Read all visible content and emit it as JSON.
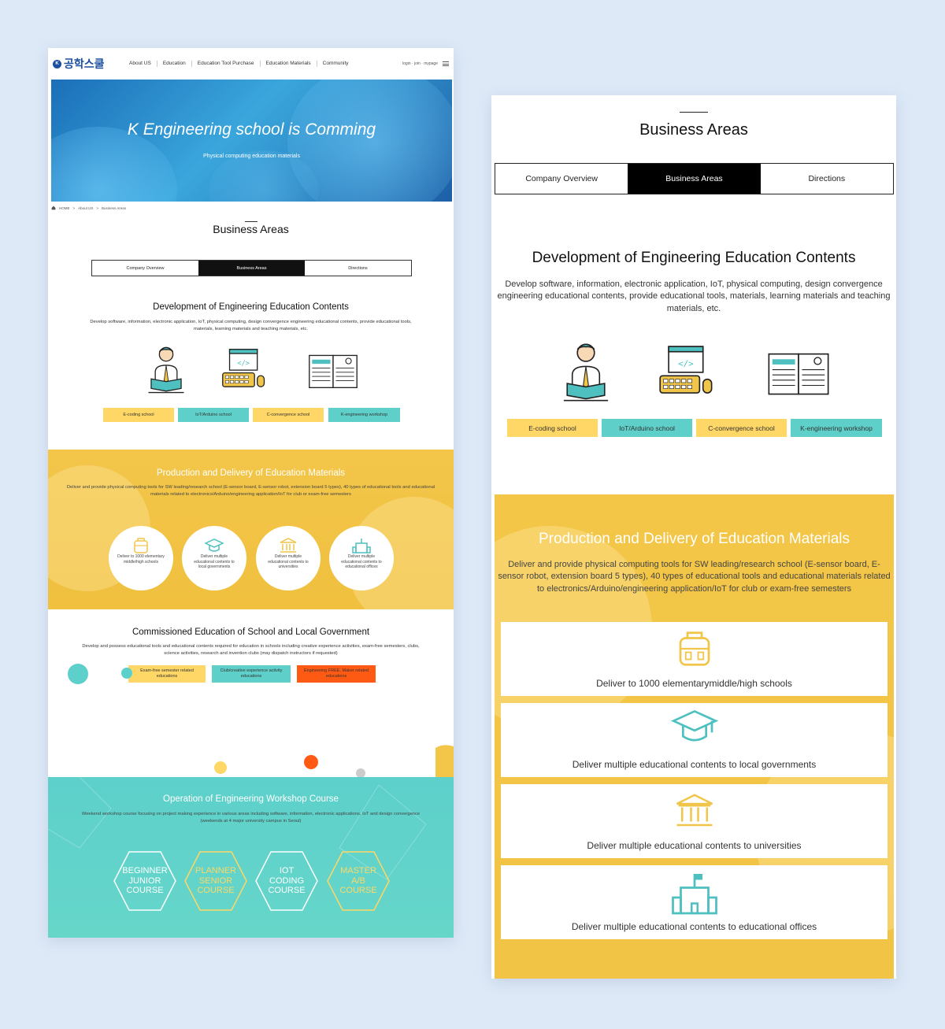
{
  "nav": {
    "logo_text": "공학스쿨",
    "logo_badge": "K",
    "menu": [
      "About US",
      "Education",
      "Education Tool Purchase",
      "Education Materials",
      "Community"
    ],
    "util": "login · join · mypage"
  },
  "hero": {
    "title": "K Engineering school is Comming",
    "subtitle": "Physical computing education materials"
  },
  "breadcrumb": [
    "HOME",
    "About US",
    "Business Areas"
  ],
  "page_title": "Business Areas",
  "tabs": [
    "Company Overview",
    "Business Areas",
    "Directions"
  ],
  "development": {
    "title": "Development of Engineering Education Contents",
    "desc_left": "Develop software, information, electronic application, IoT, physical computing, design convergence engineering educational contents, provide educational tools, materials, learning materials and teaching materials, etc.",
    "desc_right": "Develop software, information, electronic application, IoT, physical computing, design convergence engineering educational contents, provide educational tools, materials, learning materials and teaching materials, etc.",
    "tags": [
      "E-coding school",
      "IoT/Arduino school",
      "C-convergence school",
      "K-engineering workshop"
    ]
  },
  "production": {
    "title": "Production and Delivery of Education Materials",
    "desc_left": "Deliver and provide physical computing tools for SW leading/research school (E-sensor board, E-sensor robot, extension board 5 types), 40 types of educational tools and educational materials related to electronics/Arduino/engineering application/IoT for club or exam-free semesters",
    "desc_right": "Deliver and provide physical computing tools for SW leading/research school (E-sensor board, E-sensor robot, extension board 5 types), 40 types of educational tools and educational materials related to electronics/Arduino/engineering application/IoT for club or exam-free semesters",
    "circles": [
      "Deliver to 1000 elementary middle/high schools",
      "Deliver multiple educational contents to local governments",
      "Deliver multiple educational contents to universities",
      "Deliver multiple educational contents to educational offices"
    ],
    "boxes": [
      "Deliver to 1000 elementarymiddle/high schools",
      "Deliver multiple educational contents to local governments",
      "Deliver multiple educational contents to universities",
      "Deliver multiple educational contents to educational offices"
    ]
  },
  "commissioned": {
    "title": "Commissioned Education of School and Local Government",
    "desc": "Develop and possess educational tools and educational contents required for education in schools including creative experience activities, exam-free semesters, clubs, science activities, research and invention clubs (may dispatch instructors if requested)",
    "tags": [
      "Exam-free semester related educations",
      "Club/creative experience activity educations",
      "Engineering FREE, Maker related educations"
    ]
  },
  "workshop": {
    "title": "Operation of Engineering Workshop Course",
    "desc": "Weekend workshop course focusing on project making experience in various areas including software, information, electronic applications, IoT and design convergence (weekends at 4 major university campus in Seoul)",
    "courses": [
      "BEGINNER\nJUNIOR\nCOURSE",
      "PLANNER\nSENIOR\nCOURSE",
      "IOT\nCODING\nCOURSE",
      "MASTER\nA/B\nCOURSE"
    ]
  },
  "colors": {
    "yellow": "#f3c64a",
    "teal": "#5dd0cb",
    "tag_yellow": "#ffd766",
    "tag_teal": "#5fd0c9",
    "orange": "#ff5a14",
    "page_bg": "#dde9f7"
  }
}
